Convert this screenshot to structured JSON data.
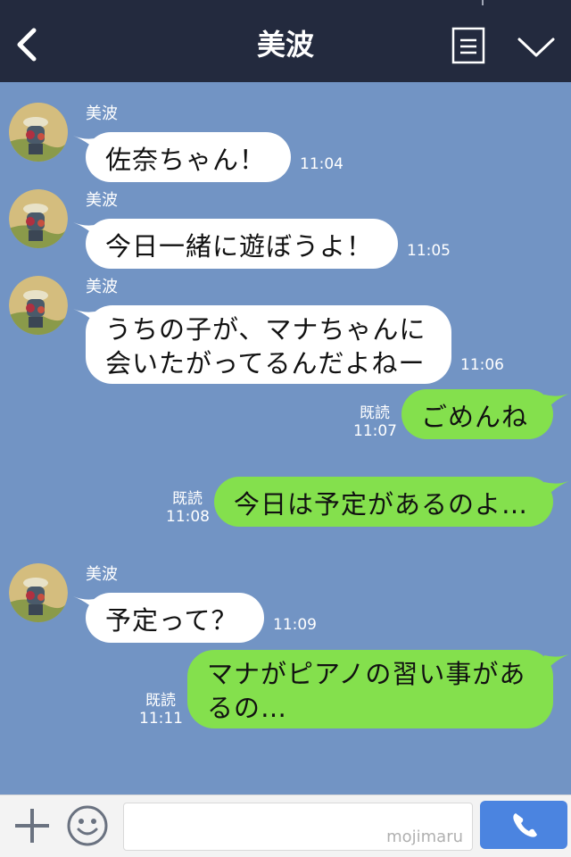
{
  "header": {
    "title": "美波",
    "back_icon": "chevron-left-icon",
    "menu_icon": "menu-list-icon",
    "collapse_icon": "chevron-down-icon"
  },
  "messages": [
    {
      "side": "in",
      "sender": "美波",
      "text": "佐奈ちゃん！",
      "time": "11:04"
    },
    {
      "side": "in",
      "sender": "美波",
      "text": "今日一緒に遊ぼうよ！",
      "time": "11:05"
    },
    {
      "side": "in",
      "sender": "美波",
      "text": "うちの子が、マナちゃんに\n会いたがってるんだよねー",
      "time": "11:06"
    },
    {
      "side": "out",
      "read": "既読",
      "text": "ごめんね",
      "time": "11:07"
    },
    {
      "side": "out",
      "read": "既読",
      "text": "今日は予定があるのよ…",
      "time": "11:08"
    },
    {
      "side": "in",
      "sender": "美波",
      "text": "予定って？",
      "time": "11:09"
    },
    {
      "side": "out",
      "read": "既読",
      "text": "マナがピアノの習い事があ\nるの…",
      "time": "11:11"
    }
  ],
  "footer": {
    "plus_icon": "plus-icon",
    "sticker_icon": "smiley-icon",
    "input_value": "",
    "watermark": "mojimaru",
    "call_icon": "phone-icon"
  },
  "colors": {
    "header_bg": "#232a3e",
    "chat_bg": "#7294c4",
    "incoming_bubble": "#ffffff",
    "outgoing_bubble": "#84e04d",
    "call_button": "#4b84e0"
  }
}
